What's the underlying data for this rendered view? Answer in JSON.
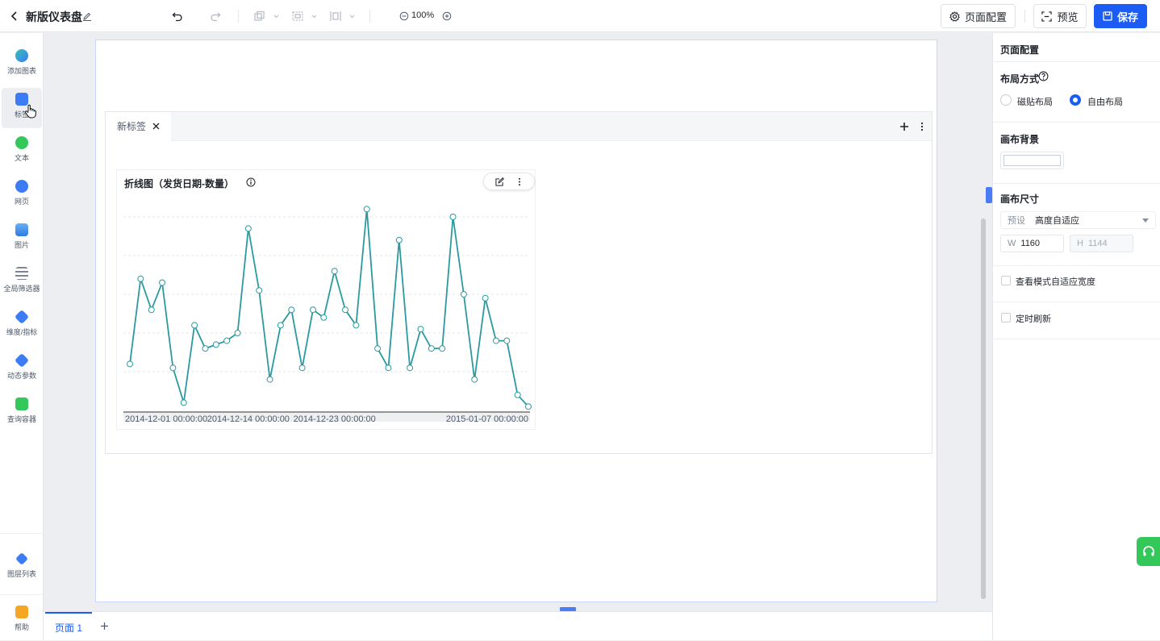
{
  "header": {
    "title": "新版仪表盘",
    "zoom": "100%",
    "page_config_label": "页面配置",
    "preview_label": "预览",
    "save_label": "保存"
  },
  "left_sidebar": {
    "items": [
      {
        "label": "添加图表",
        "icon": "add-chart-icon",
        "color": "#2bb3a6"
      },
      {
        "label": "标签",
        "icon": "tag-icon",
        "color": "#3b7cf5"
      },
      {
        "label": "文本",
        "icon": "text-icon",
        "color": "#34c759"
      },
      {
        "label": "网页",
        "icon": "web-icon",
        "color": "#3b7cf5"
      },
      {
        "label": "图片",
        "icon": "image-icon",
        "color": "#3b7cf5"
      },
      {
        "label": "全局筛选器",
        "icon": "filter-icon",
        "color": "#7a8599"
      },
      {
        "label": "维度/指标",
        "icon": "dimension-icon",
        "color": "#3b7cf5"
      },
      {
        "label": "动态参数",
        "icon": "param-icon",
        "color": "#3b7cf5"
      },
      {
        "label": "查询容器",
        "icon": "query-icon",
        "color": "#34c759"
      }
    ],
    "layers_label": "图层列表",
    "help_label": "帮助"
  },
  "tab_container": {
    "tab_label": "新标签"
  },
  "chart_data": {
    "type": "line",
    "title": "折线图（发货日期-数量）",
    "x_tick_labels": [
      "2014-12-01 00:00:00",
      "2014-12-14 00:00:00",
      "2014-12-23 00:00:00",
      "2015-01-07 00:00:00"
    ],
    "x_tick_index": [
      0,
      11,
      19,
      30
    ],
    "ylim": [
      0,
      25
    ],
    "grid": true,
    "series_color": "#2a9aa0",
    "values": [
      6,
      17,
      13,
      16.5,
      5.5,
      1,
      11,
      8,
      8.5,
      9,
      10,
      23.5,
      15.5,
      4,
      11,
      13,
      5.5,
      13,
      12,
      18,
      13,
      11,
      26,
      8,
      5.5,
      22,
      5.5,
      10.5,
      8,
      8,
      25,
      15,
      4,
      14.5,
      9,
      9,
      2,
      0.5
    ]
  },
  "pages": {
    "tab_label": "页面 1"
  },
  "right_panel": {
    "title": "页面配置",
    "layout_label": "布局方式",
    "layout_options": [
      "磁贴布局",
      "自由布局"
    ],
    "layout_selected": "自由布局",
    "background_label": "画布背景",
    "size_label": "画布尺寸",
    "preset_label": "预设",
    "preset_value": "高度自适应",
    "w_label": "W",
    "w_value": "1160",
    "h_label": "H",
    "h_value": "1144",
    "adaptive_label": "查看模式自适应宽度",
    "refresh_label": "定时刷新"
  }
}
